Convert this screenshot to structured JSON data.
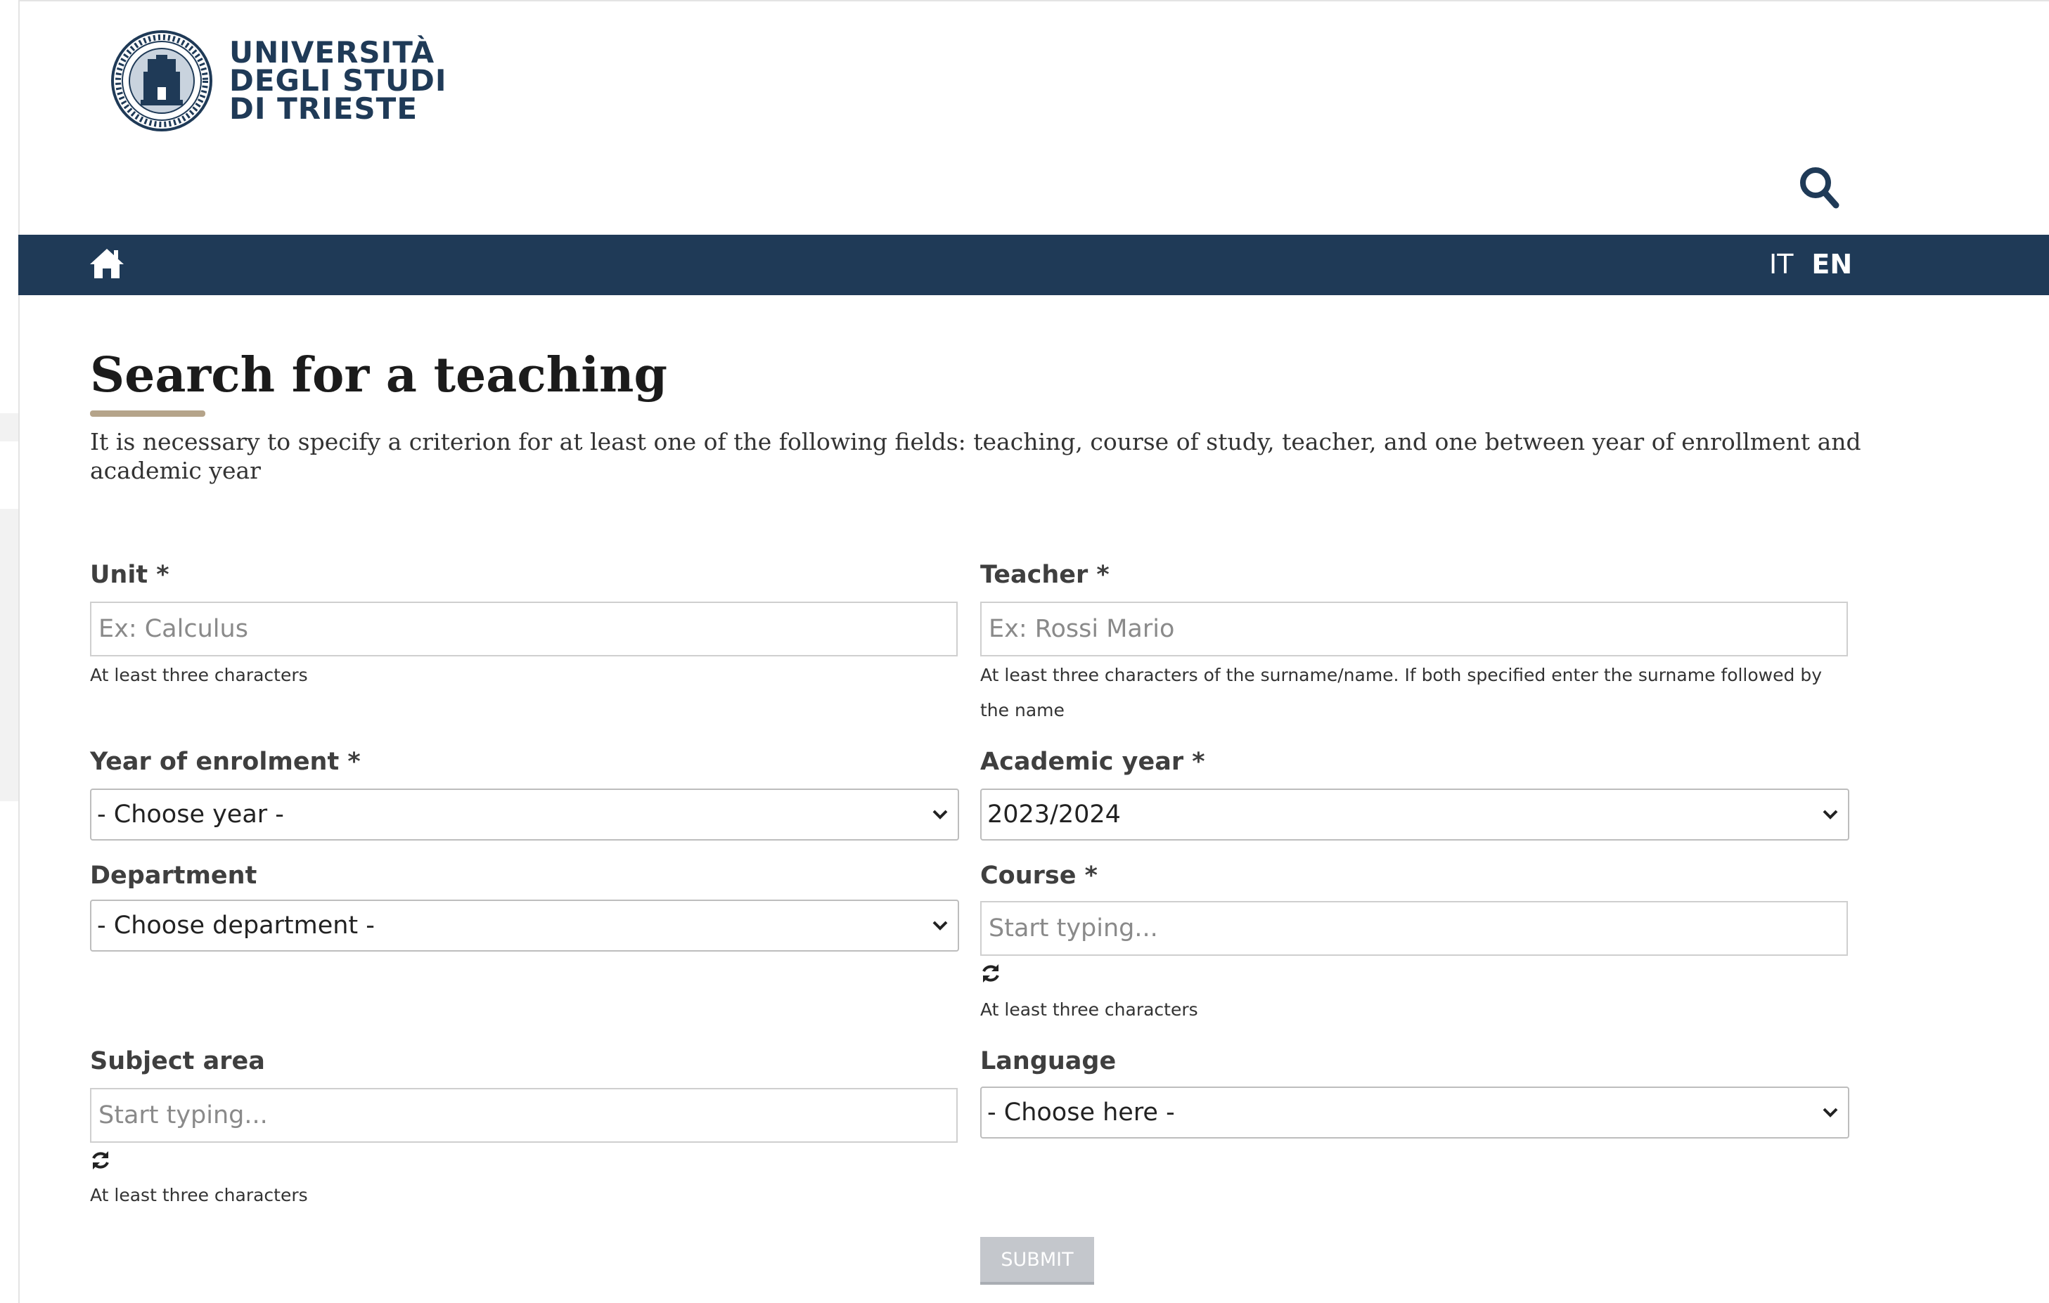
{
  "header": {
    "logo_lines": [
      "UNIVERSITÀ",
      "DEGLI STUDI",
      "DI TRIESTE"
    ],
    "logo_alt": "Università degli Studi di Trieste seal",
    "brand_color": "#1f3a57",
    "search_icon": "search-icon"
  },
  "navbar": {
    "background": "#1f3a57",
    "home_icon": "home-icon",
    "languages": [
      "IT",
      "EN"
    ],
    "active_language": "EN"
  },
  "page": {
    "title": "Search for a teaching",
    "intro": "It is necessary to specify a criterion for at least one of the following fields: teaching, course of study, teacher, and one between year of enrollment and academic year"
  },
  "form": {
    "unit": {
      "label": "Unit *",
      "placeholder": "Ex: Calculus",
      "value": "",
      "help": "At least three characters"
    },
    "teacher": {
      "label": "Teacher *",
      "placeholder": "Ex: Rossi Mario",
      "value": "",
      "help": "At least three characters of the surname/name. If both specified enter the surname followed by the name"
    },
    "year_of_enrolment": {
      "label": "Year of enrolment *",
      "selected": "- Choose year -"
    },
    "academic_year": {
      "label": "Academic year *",
      "selected": "2023/2024"
    },
    "department": {
      "label": "Department",
      "selected": "- Choose department -"
    },
    "course": {
      "label": "Course *",
      "placeholder": "Start typing...",
      "value": "",
      "help": "At least three characters"
    },
    "subject_area": {
      "label": "Subject area",
      "placeholder": "Start typing...",
      "value": "",
      "help": "At least three characters"
    },
    "language": {
      "label": "Language",
      "selected": "- Choose here -"
    },
    "submit_label": "SUBMIT"
  }
}
